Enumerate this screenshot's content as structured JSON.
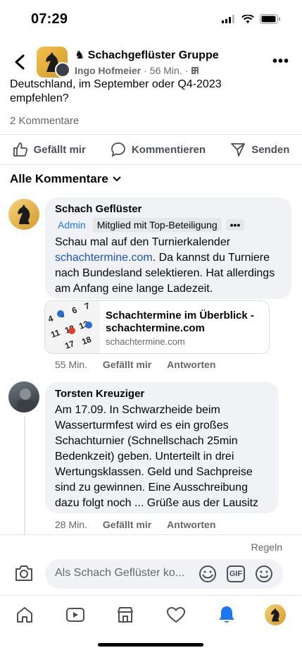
{
  "status": {
    "time": "07:29"
  },
  "header": {
    "group_name": "♞ Schachgeflüster Gruppe",
    "author": "Ingo Hofmeier",
    "time": "56 Min.",
    "more_label": "•••"
  },
  "post": {
    "text_line1": "Deutschland, im September oder Q4-2023",
    "text_line2": "empfehlen?",
    "comment_count": "2 Kommentare"
  },
  "actions": {
    "like": "Gefällt mir",
    "comment": "Kommentieren",
    "share": "Senden"
  },
  "sort_label": "Alle Kommentare",
  "comments": [
    {
      "name": "Schach Geflüster",
      "badge_admin": "Admin",
      "badge_top": "Mitglied mit Top-Beteiligung",
      "badge_more": "•••",
      "text_before": "Schau mal auf den Turnierkalender ",
      "link": "schachtermine.com",
      "text_after": ". Da kannst du Turniere nach Bundesland selektieren. Hat allerdings am Anfang eine lange Ladezeit.",
      "preview_title": "Schachtermine im Überblick - schachtermine.com",
      "preview_domain": "schachtermine.com",
      "time": "55 Min.",
      "like": "Gefällt mir",
      "reply": "Antworten"
    },
    {
      "name": "Torsten Kreuziger",
      "text": "Am 17.09. In Schwarzheide beim Wasserturmfest wird es ein großes Schachturnier (Schnellschach 25min Bedenkzeit) geben. Unterteilt in drei Wertungsklassen. Geld und Sachpreise sind zu gewinnen. Eine Ausschreibung dazu folgt noch ... Grüße aus der Lausitz",
      "time": "28 Min.",
      "like": "Gefällt mir",
      "reply": "Antworten"
    }
  ],
  "composer": {
    "rules": "Regeln",
    "placeholder": "Als Schach Geflüster ko...",
    "gif": "GIF"
  },
  "colors": {
    "accent": "#1877f2",
    "bubble": "#f0f2f5",
    "secondary_text": "#65676b",
    "link": "#1a56b3"
  },
  "icons": [
    "back-icon",
    "office-icon",
    "like-icon",
    "comment-icon",
    "share-icon",
    "chevron-down-icon",
    "camera-icon",
    "sticker-icon",
    "gif-icon",
    "emoji-icon",
    "home-icon",
    "video-icon",
    "marketplace-icon",
    "dating-icon",
    "bell-icon",
    "profile-avatar"
  ]
}
